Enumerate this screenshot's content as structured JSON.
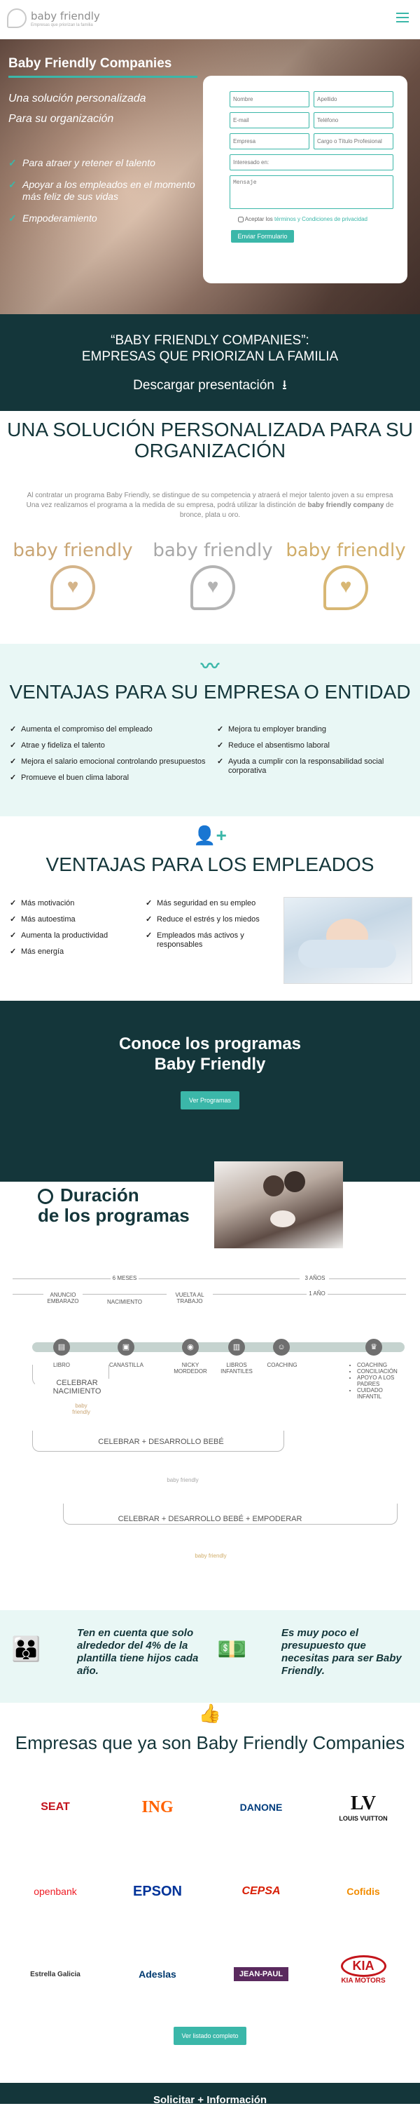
{
  "header": {
    "brand": "baby friendly",
    "brand_sub": "Empresas que priorizan la familia",
    "menu_icon": "hamburger-icon"
  },
  "hero": {
    "title": "Baby Friendly Companies",
    "subtitle_1": "Una solución personalizada",
    "subtitle_2": "Para su organización",
    "bullets": [
      "Para atraer y retener el talento",
      "Apoyar a los empleados en el momento más feliz de sus vidas",
      "Empoderamiento"
    ]
  },
  "form": {
    "title": "Solicitar Información",
    "nombre": "Nombre",
    "apellido": "Apellido",
    "email": "E-mail",
    "telefono": "Teléfono",
    "empresa": "Empresa",
    "cargo": "Cargo o Título Profesional",
    "interes": "Interesado en:",
    "mensaje": "Mensaje",
    "consent_prefix": "Aceptar los",
    "consent_link": "términos y Condiciones de privacidad",
    "submit": "Enviar Formulario"
  },
  "band1": {
    "title_1": "“BABY FRIENDLY COMPANIES”:",
    "title_2": "EMPRESAS QUE PRIORIZAN LA FAMILIA",
    "download": "Descargar presentación"
  },
  "solution": {
    "title": "UNA SOLUCIÓN PERSONALIZADA PARA SU ORGANIZACIÓN",
    "paragraph_1": "Al contratar un programa Baby Friendly, se distingue de su competencia y atraerá el mejor talento joven a su empresa",
    "paragraph_2a": "Una vez realizamos el programa a la medida de su empresa, podrá utilizar la distinción de ",
    "paragraph_2b": "baby friendly company",
    "paragraph_2c": " de bronce, plata u oro.",
    "badges": [
      "baby friendly",
      "baby friendly",
      "baby friendly"
    ]
  },
  "company": {
    "title": "VENTAJAS PARA SU EMPRESA O ENTIDAD",
    "left": [
      "Aumenta el compromiso del empleado",
      "Atrae y fideliza el talento",
      "Mejora el salario emocional controlando presupuestos",
      "Promueve el buen clima laboral"
    ],
    "right": [
      "Mejora tu employer branding",
      "Reduce el absentismo laboral",
      "Ayuda a cumplir con la responsabilidad social corporativa"
    ]
  },
  "employees": {
    "title": "VENTAJAS PARA LOS EMPLEADOS",
    "left": [
      "Más motivación",
      "Más autoestima",
      "Aumenta la productividad",
      "Más energía"
    ],
    "right": [
      "Más seguridad en su empleo",
      "Reduce el estrés y los miedos",
      "Empleados más activos y responsables"
    ]
  },
  "programs": {
    "title_1": "Conoce los programas",
    "title_2": "Baby Friendly",
    "button": "Ver Programas"
  },
  "duration": {
    "title_1": "Duración",
    "title_2": "de los programas",
    "seis_meses": "6 MESES",
    "tres_anos": "3 AÑOS",
    "un_ano": "1 AÑO",
    "milestones": [
      "ANUNCIO EMBARAZO",
      "NACIMIENTO",
      "VUELTA AL TRABAJO"
    ],
    "nodes": [
      "LIBRO",
      "CANASTILLA",
      "NICKY MORDEDOR",
      "LIBROS INFANTILES",
      "COACHING"
    ],
    "final_list": [
      "COACHING",
      "CONCILIACIÓN",
      "APOYO A LOS PADRES",
      "CUIDADO INFANTIL"
    ],
    "celebrar_1": "CELEBRAR NACIMIENTO",
    "celebrar_2": "CELEBRAR + DESARROLLO BEBÉ",
    "celebrar_3": "CELEBRAR + DESARROLLO BEBÉ + EMPODERAR",
    "medal": "baby friendly"
  },
  "notes": {
    "left": "Ten en cuenta que solo alrededor del 4% de la plantilla tiene hijos cada año.",
    "right": "Es muy poco el presupuesto que necesitas para ser Baby Friendly."
  },
  "companies": {
    "title": "Empresas que ya son Baby Friendly Companies",
    "logos": [
      "SEAT",
      "ING",
      "DANONE",
      "LOUIS VUITTON",
      "openbank",
      "EPSON",
      "CEPSA",
      "Cofidis",
      "Estrella Galicia",
      "Adeslas",
      "JEAN-PAUL",
      "KIA MOTORS"
    ],
    "button": "Ver listado completo"
  },
  "footer": {
    "title": "Solicitar + Información"
  },
  "colors": {
    "teal": "#3bb7a9",
    "dark": "#14363a",
    "mint": "#e9f7f5",
    "gold": "#c9a574",
    "silver": "#a8a8a8"
  }
}
